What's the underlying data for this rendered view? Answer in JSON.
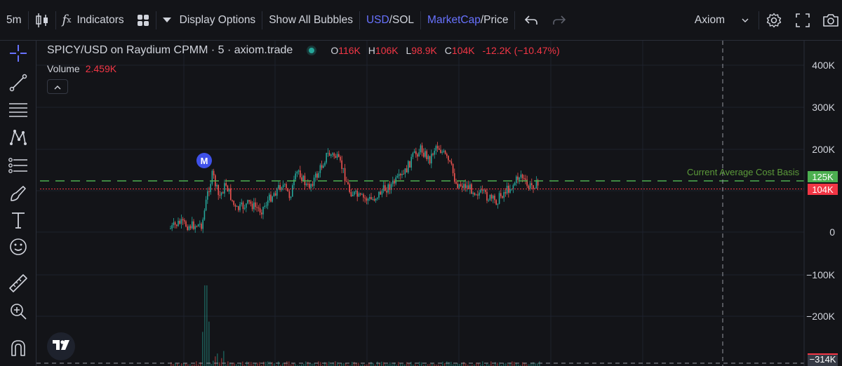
{
  "toolbar": {
    "timeframe": "5m",
    "indicators_label": "Indicators",
    "display_options_label": "Display Options",
    "show_all_bubbles_label": "Show All Bubbles",
    "currency_primary": "USD",
    "currency_secondary": "/SOL",
    "metric_primary": "MarketCap",
    "metric_secondary": "/Price",
    "layout_label": "Axiom"
  },
  "legend": {
    "title": "SPICY/USD on Raydium CPMM · 5 · axiom.trade",
    "open_label": "O",
    "open_value": "116K",
    "high_label": "H",
    "high_value": "106K",
    "low_label": "L",
    "low_value": "98.9K",
    "close_label": "C",
    "close_value": "104K",
    "change_value": "-12.2K (−10.47%)",
    "volume_label": "Volume",
    "volume_value": "2.459K"
  },
  "price_axis": {
    "labels": [
      "400K",
      "300K",
      "200K",
      "0",
      "−100K",
      "−200K",
      "−314K"
    ]
  },
  "price_tags": {
    "avg_cost": "125K",
    "current": "104K"
  },
  "annotations": {
    "avg_cost_label": "Current Average Cost Basis",
    "marker_label": "M"
  },
  "colors": {
    "up": "#26a69a",
    "down": "#ef5350",
    "avg_cost_line": "#4caf50",
    "current_line": "#f23645",
    "accent": "#6872ff"
  },
  "icons": {
    "toolbar": [
      "candles-icon",
      "fx-icon",
      "templates-icon",
      "dropdown-arrow-icon",
      "undo-icon",
      "redo-icon",
      "chevron-down-icon",
      "gear-icon",
      "fullscreen-icon",
      "camera-icon"
    ],
    "leftbar": [
      "crosshair-icon",
      "trendline-icon",
      "horizontal-lines-icon",
      "pattern-icon",
      "fib-icon",
      "brush-icon",
      "text-icon",
      "emoji-icon",
      "ruler-icon",
      "zoom-in-icon",
      "magnet-icon"
    ]
  }
}
